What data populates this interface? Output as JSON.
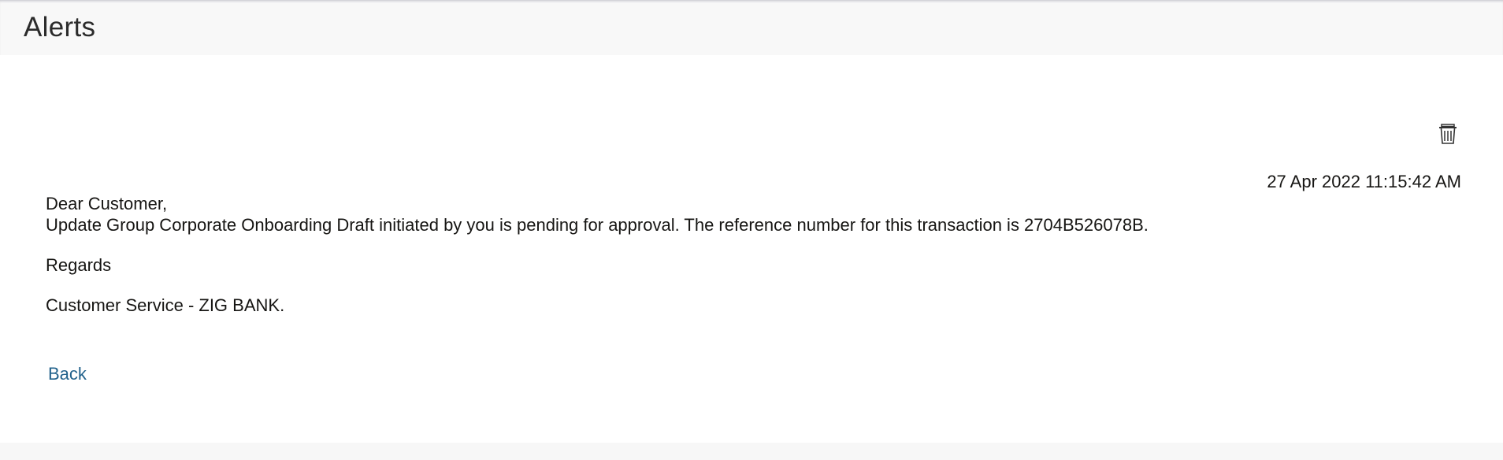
{
  "header": {
    "title": "Alerts"
  },
  "alert": {
    "timestamp": "27 Apr 2022 11:15:42 AM",
    "greeting": "Dear Customer,",
    "body": "Update Group Corporate Onboarding Draft initiated by you is pending for approval. The reference number for this transaction is 2704B526078B.",
    "closing": "Regards",
    "signature": "Customer Service - ZIG BANK."
  },
  "actions": {
    "delete_icon": "trash-icon",
    "back_label": "Back"
  },
  "colors": {
    "link": "#22628c",
    "header_bg": "#f8f8f8",
    "text": "#161513"
  }
}
